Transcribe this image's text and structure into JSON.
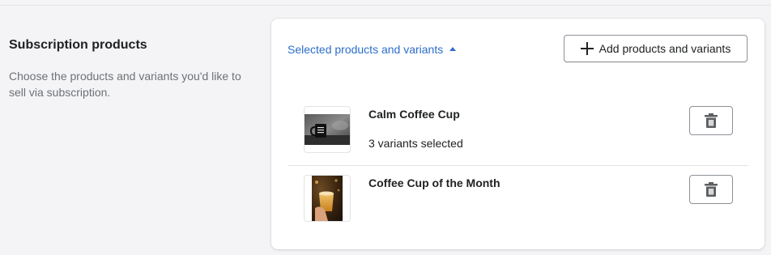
{
  "section": {
    "title": "Subscription products",
    "description": "Choose the products and variants you'd like to sell via subscription."
  },
  "card": {
    "toggle_label": "Selected products and variants",
    "toggle_icon": "caret-up-icon",
    "add_button_label": "Add products and variants",
    "add_button_icon": "plus-icon"
  },
  "products": [
    {
      "name": "Calm Coffee Cup",
      "variants_text": "3 variants selected",
      "thumbnail": "coffee-mug-photo",
      "delete_icon": "trash-icon"
    },
    {
      "name": "Coffee Cup of the Month",
      "variants_text": "",
      "thumbnail": "latte-glass-photo",
      "delete_icon": "trash-icon"
    }
  ],
  "colors": {
    "page_background": "#f4f4f6",
    "card_background": "#ffffff",
    "link": "#2c6ecb",
    "text_primary": "#202223",
    "text_subdued": "#6d7175",
    "border": "#8c9196",
    "divider": "#e1e3e5"
  }
}
